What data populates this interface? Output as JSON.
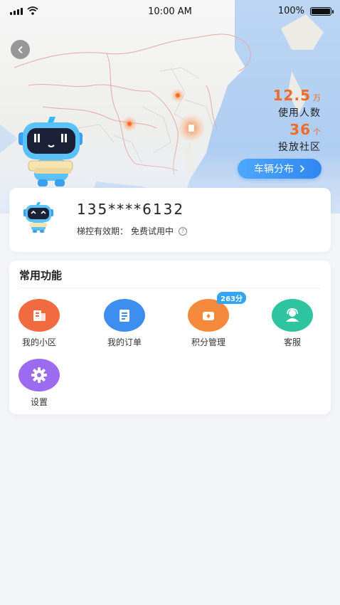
{
  "status_bar": {
    "time": "10:00 AM",
    "battery": "100%"
  },
  "stats": {
    "users": {
      "value": "12.5",
      "unit": "万",
      "label": "使用人数"
    },
    "communities": {
      "value": "36",
      "unit": "个",
      "label": "投放社区"
    }
  },
  "vehicle_button": {
    "label": "车辆分布",
    "icon": "chevron-right-icon"
  },
  "account": {
    "phone": "135****6132",
    "validity_label": "梯控有效期：",
    "validity_value": "免费试用中"
  },
  "functions": {
    "title": "常用功能",
    "items": [
      {
        "label": "我的小区",
        "color": "#f26a3f",
        "icon": "building-icon"
      },
      {
        "label": "我的订单",
        "color": "#3e8ef0",
        "icon": "order-icon"
      },
      {
        "label": "积分管理",
        "color": "#f58a3c",
        "icon": "points-icon",
        "badge": "263分"
      },
      {
        "label": "客服",
        "color": "#2fc4a0",
        "icon": "customer-service-icon"
      },
      {
        "label": "设置",
        "color": "#9b6cf0",
        "icon": "settings-gear-icon"
      }
    ]
  },
  "colors": {
    "accent": "#2f86f0",
    "highlight": "#f06a28",
    "background": "#f3f5f9"
  }
}
